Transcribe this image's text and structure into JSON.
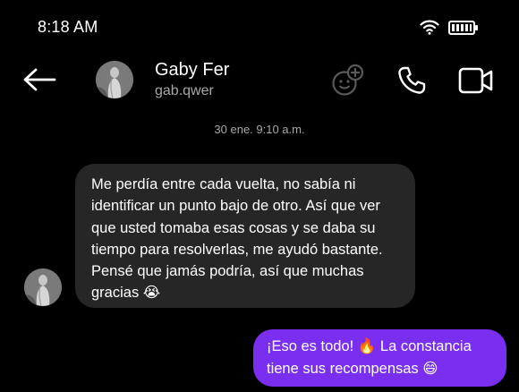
{
  "status_bar": {
    "time": "8:18 AM",
    "icons": [
      "wifi-icon",
      "battery-icon"
    ]
  },
  "header": {
    "back_icon": "arrow-left-icon",
    "contact_name": "Gaby Fer",
    "contact_username": "gab.qwer",
    "actions": [
      "avatar-add-icon",
      "phone-icon",
      "video-camera-icon"
    ]
  },
  "conversation": {
    "timestamp": "30 ene. 9:10 a.m.",
    "messages": [
      {
        "direction": "received",
        "text": "Me perdía entre cada vuelta, no sabía ni identificar un punto bajo de otro. Así que ver que usted tomaba esas cosas y se daba su tiempo para resolverlas, me ayudó bastante. Pensé que jamás podría, así que muchas gracias 😭"
      },
      {
        "direction": "sent",
        "text": "¡Eso es todo! 🔥 La constancia tiene sus recompensas 😄"
      }
    ]
  },
  "colors": {
    "background": "#000000",
    "received_bubble": "#262626",
    "sent_bubble": "#7a2ff0",
    "secondary_text": "#a8a8a8"
  }
}
